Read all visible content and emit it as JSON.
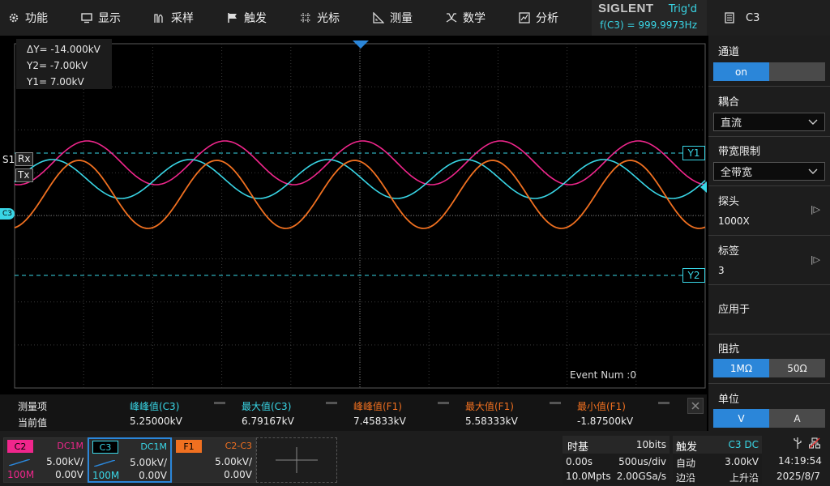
{
  "menu": {
    "items": [
      {
        "label": "功能",
        "icon": "gear-icon"
      },
      {
        "label": "显示",
        "icon": "monitor-icon"
      },
      {
        "label": "采样",
        "icon": "acquire-icon"
      },
      {
        "label": "触发",
        "icon": "flag-icon"
      },
      {
        "label": "光标",
        "icon": "cursor-icon"
      },
      {
        "label": "测量",
        "icon": "ruler-icon"
      },
      {
        "label": "数学",
        "icon": "math-icon"
      },
      {
        "label": "分析",
        "icon": "analysis-icon"
      }
    ]
  },
  "brand": {
    "logo": "SIGLENT",
    "trig_status": "Trig'd",
    "frequency": "f(C3) = 999.9973Hz"
  },
  "channel_header": {
    "title": "C3",
    "icon": "document-icon"
  },
  "cursor_readout": {
    "delta_y": "ΔY= -14.000kV",
    "y2": "Y2= -7.00kV",
    "y1": "Y1= 7.00kV"
  },
  "screen_labels": {
    "s1": "S1",
    "rx": "Rx",
    "tx": "Tx",
    "c3_marker": "C3",
    "y1_tag": "Y1",
    "y2_tag": "Y2",
    "event_num": "Event Num :0"
  },
  "panel": {
    "channel": {
      "label": "通道",
      "on": "on",
      "off": ""
    },
    "coupling": {
      "label": "耦合",
      "value": "直流"
    },
    "bandwidth": {
      "label": "带宽限制",
      "value": "全带宽"
    },
    "probe": {
      "label": "探头",
      "value": "1000X"
    },
    "tag": {
      "label": "标签",
      "value": "3"
    },
    "apply": {
      "label": "应用于"
    },
    "impedance": {
      "label": "阻抗",
      "opt1": "1MΩ",
      "opt2": "50Ω"
    },
    "unit": {
      "label": "单位",
      "opt1": "V",
      "opt2": "A"
    }
  },
  "measure": {
    "row1_label": "测量项",
    "row2_label": "当前值",
    "columns": [
      {
        "name": "峰峰值(C3)",
        "value": "5.25000kV",
        "color": "#39d6e6"
      },
      {
        "name": "最大值(C3)",
        "value": "6.79167kV",
        "color": "#39d6e6"
      },
      {
        "name": "峰峰值(F1)",
        "value": "7.45833kV",
        "color": "#f07020"
      },
      {
        "name": "最大值(F1)",
        "value": "5.58333kV",
        "color": "#f07020"
      },
      {
        "name": "最小值(F1)",
        "value": "-1.87500kV",
        "color": "#f07020"
      }
    ]
  },
  "channels": [
    {
      "tag": "C2",
      "coupling": "DC1M",
      "scale": "5.00kV/",
      "bw": "100M",
      "offset": "0.00V",
      "color": "#f0268c"
    },
    {
      "tag": "C3",
      "coupling": "DC1M",
      "scale": "5.00kV/",
      "bw": "100M",
      "offset": "0.00V",
      "color": "#39d6e6"
    },
    {
      "tag": "F1",
      "coupling": "C2-C3",
      "scale": "5.00kV/",
      "bw": "",
      "offset": "0.00V",
      "color": "#f07020"
    }
  ],
  "timebase": {
    "label": "时基",
    "bits": "10bits",
    "delay": "0.00s",
    "scale": "500us/div",
    "points": "10.0Mpts",
    "rate": "2.00GSa/s"
  },
  "trigger": {
    "label": "触发",
    "source": "C3 DC",
    "mode": "自动",
    "level": "3.00kV",
    "type": "边沿",
    "slope": "上升沿"
  },
  "clock": {
    "time": "14:19:54",
    "date": "2025/8/7",
    "usb_icon": "usb-icon",
    "network_icon": "network-icon"
  },
  "colors": {
    "c2": "#f0268c",
    "c3": "#39d6e6",
    "f1": "#f07020",
    "accent": "#2b86d9"
  }
}
